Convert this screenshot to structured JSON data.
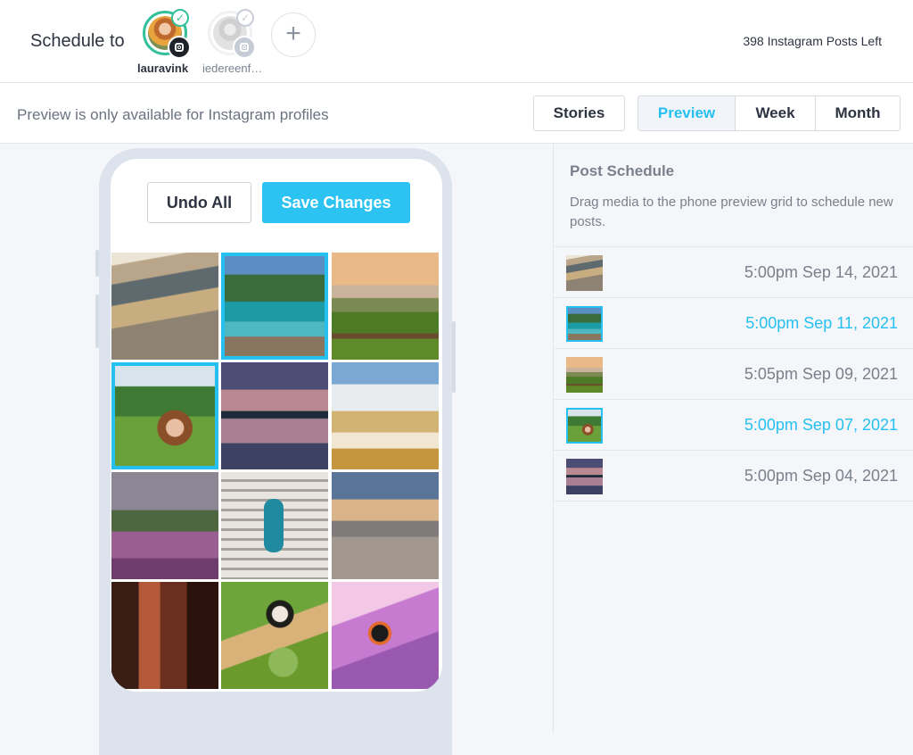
{
  "header": {
    "schedule_label": "Schedule to",
    "profiles": [
      {
        "name": "lauravink",
        "active": true
      },
      {
        "name": "iedereenf…",
        "active": false
      }
    ],
    "add_icon": "plus-icon",
    "posts_left": "398 Instagram Posts Left"
  },
  "toolbar": {
    "note": "Preview is only available for Instagram profiles",
    "stories_label": "Stories",
    "views": [
      {
        "label": "Preview",
        "selected": true
      },
      {
        "label": "Week",
        "selected": false
      },
      {
        "label": "Month",
        "selected": false
      }
    ]
  },
  "phone": {
    "undo_label": "Undo All",
    "save_label": "Save Changes",
    "grid": [
      {
        "image": "architecture-interior",
        "selected": false
      },
      {
        "image": "rocky-coast",
        "selected": true
      },
      {
        "image": "green-field-path",
        "selected": false
      },
      {
        "image": "woman-jungle-portrait",
        "selected": true
      },
      {
        "image": "lake-sunset-reflection",
        "selected": false
      },
      {
        "image": "sand-dunes",
        "selected": false
      },
      {
        "image": "heather-field",
        "selected": false
      },
      {
        "image": "woman-on-stairs",
        "selected": false
      },
      {
        "image": "beach-sunset",
        "selected": false
      },
      {
        "image": "canyon-petra",
        "selected": false
      },
      {
        "image": "squirrel-monkey",
        "selected": false
      },
      {
        "image": "butterfly-on-flowers",
        "selected": false
      }
    ]
  },
  "panel": {
    "title": "Post Schedule",
    "description": "Drag media to the phone preview grid to schedule new posts.",
    "schedule": [
      {
        "time": "5:00pm Sep 14, 2021",
        "image": "architecture-interior",
        "selected": false
      },
      {
        "time": "5:00pm Sep 11, 2021",
        "image": "rocky-coast",
        "selected": true
      },
      {
        "time": "5:05pm Sep 09, 2021",
        "image": "green-field-path",
        "selected": false
      },
      {
        "time": "5:00pm Sep 07, 2021",
        "image": "woman-jungle-portrait",
        "selected": true
      },
      {
        "time": "5:00pm Sep 04, 2021",
        "image": "lake-sunset-reflection",
        "selected": false
      }
    ]
  },
  "colors": {
    "accent": "#26c0f0",
    "active_ring": "#34c09a",
    "muted_text": "#7a818d"
  }
}
